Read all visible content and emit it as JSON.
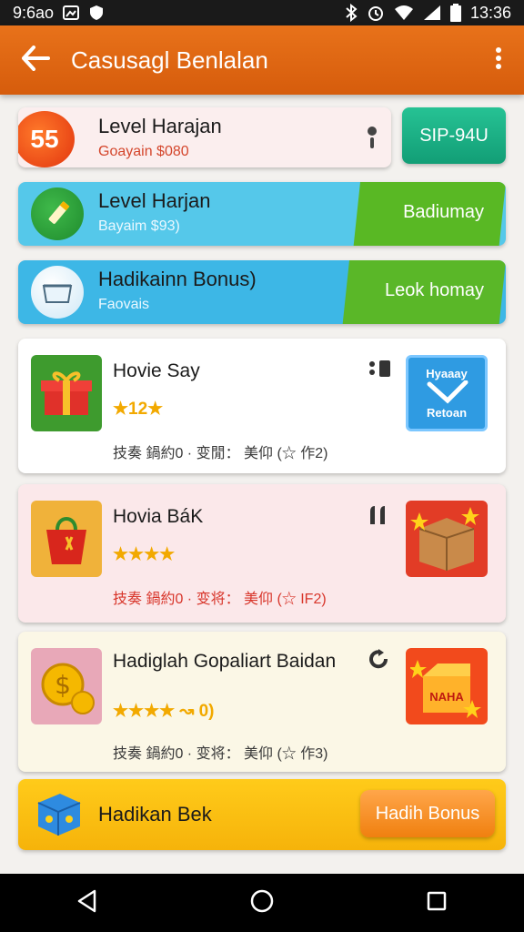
{
  "status_bar": {
    "time_left": "9:6ao",
    "clock": "13:36",
    "icons": [
      "gallery-icon",
      "shield-icon",
      "bluetooth-icon",
      "alarm-icon",
      "wifi-icon",
      "signal-icon",
      "battery-icon"
    ]
  },
  "app_bar": {
    "title": "Casusagl Benlalan",
    "back_icon": "arrow-left-icon",
    "menu_icon": "more-vert-icon"
  },
  "banners": [
    {
      "title": "Level Harajan",
      "subtitle": "Goayain  $080",
      "badge": "55",
      "action": "SIP-94U",
      "action_color": "#1aa67f"
    },
    {
      "title": "Level Harjan",
      "subtitle": "Bayaim  $93)",
      "action": "Badiumay",
      "icon": "pencil-icon"
    },
    {
      "title": "Hadikainn Bonus)",
      "subtitle": "Faovais",
      "action": "Leok homay",
      "icon": "basket-icon"
    }
  ],
  "products": [
    {
      "title": "Hovie Say",
      "stars_text": "★12★",
      "meta": "技奏 鍋約0 · 变閒： 美仰 (☆ 作2)",
      "thumb_icon": "gift-box-icon",
      "tile_text": [
        "Hyaaay",
        "Retoan"
      ],
      "tile_icon": "clock-tile-icon"
    },
    {
      "title": "Hovia BáK",
      "stars_text": "★★★★",
      "meta": "技奏 鍋約0 · 变将： 美仰 (☆ IF2)",
      "thumb_icon": "gift-bag-icon",
      "tile_icon": "cardboard-box-icon"
    },
    {
      "title": "Hadiglah Gopaliart Baidan",
      "stars_text": "★★★★  ↝  0)",
      "meta": "技奏 鍋約0 · 变将： 美仰 (☆ 作3)",
      "thumb_icon": "gold-coins-icon",
      "tile_text": [
        "NAHA"
      ],
      "tile_icon": "prize-box-icon"
    }
  ],
  "bottom_banner": {
    "title": "Hadikan Bek",
    "button": "Hadih Bonus",
    "icon": "dice-cube-icon"
  },
  "nav": [
    "back-triangle-icon",
    "home-circle-icon",
    "recents-square-icon"
  ]
}
